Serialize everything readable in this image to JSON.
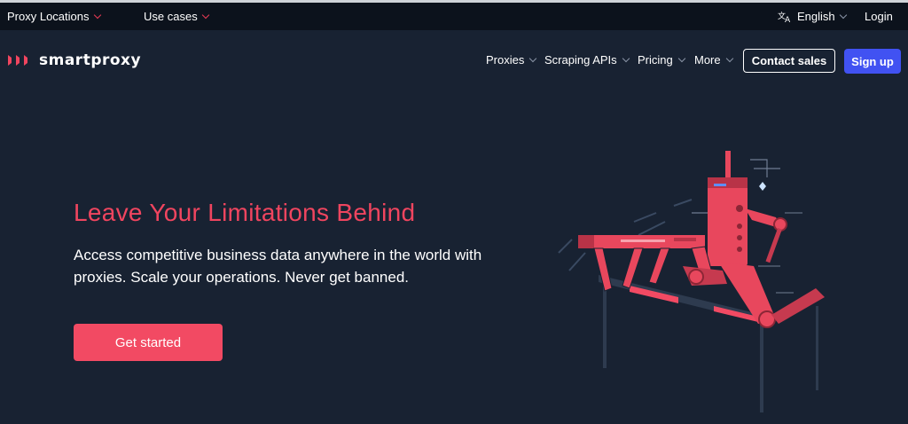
{
  "topbar": {
    "proxy_locations": "Proxy Locations",
    "use_cases": "Use cases",
    "language": "English",
    "login": "Login"
  },
  "navbar": {
    "logo_text": "smartproxy",
    "items": [
      {
        "label": "Proxies"
      },
      {
        "label": "Scraping APIs"
      },
      {
        "label": "Pricing"
      },
      {
        "label": "More"
      }
    ],
    "contact_sales": "Contact sales",
    "sign_up": "Sign up"
  },
  "hero": {
    "title": "Leave Your Limitations Behind",
    "subtitle": "Access competitive business data anywhere in the world with proxies. Scale your operations. Never get banned.",
    "cta": "Get started"
  },
  "colors": {
    "background": "#182232",
    "topbar": "#0c121c",
    "accent": "#f0455f",
    "signup": "#4152f2"
  },
  "icons": [
    "chevron-down-icon",
    "translate-icon",
    "logo-icon"
  ]
}
